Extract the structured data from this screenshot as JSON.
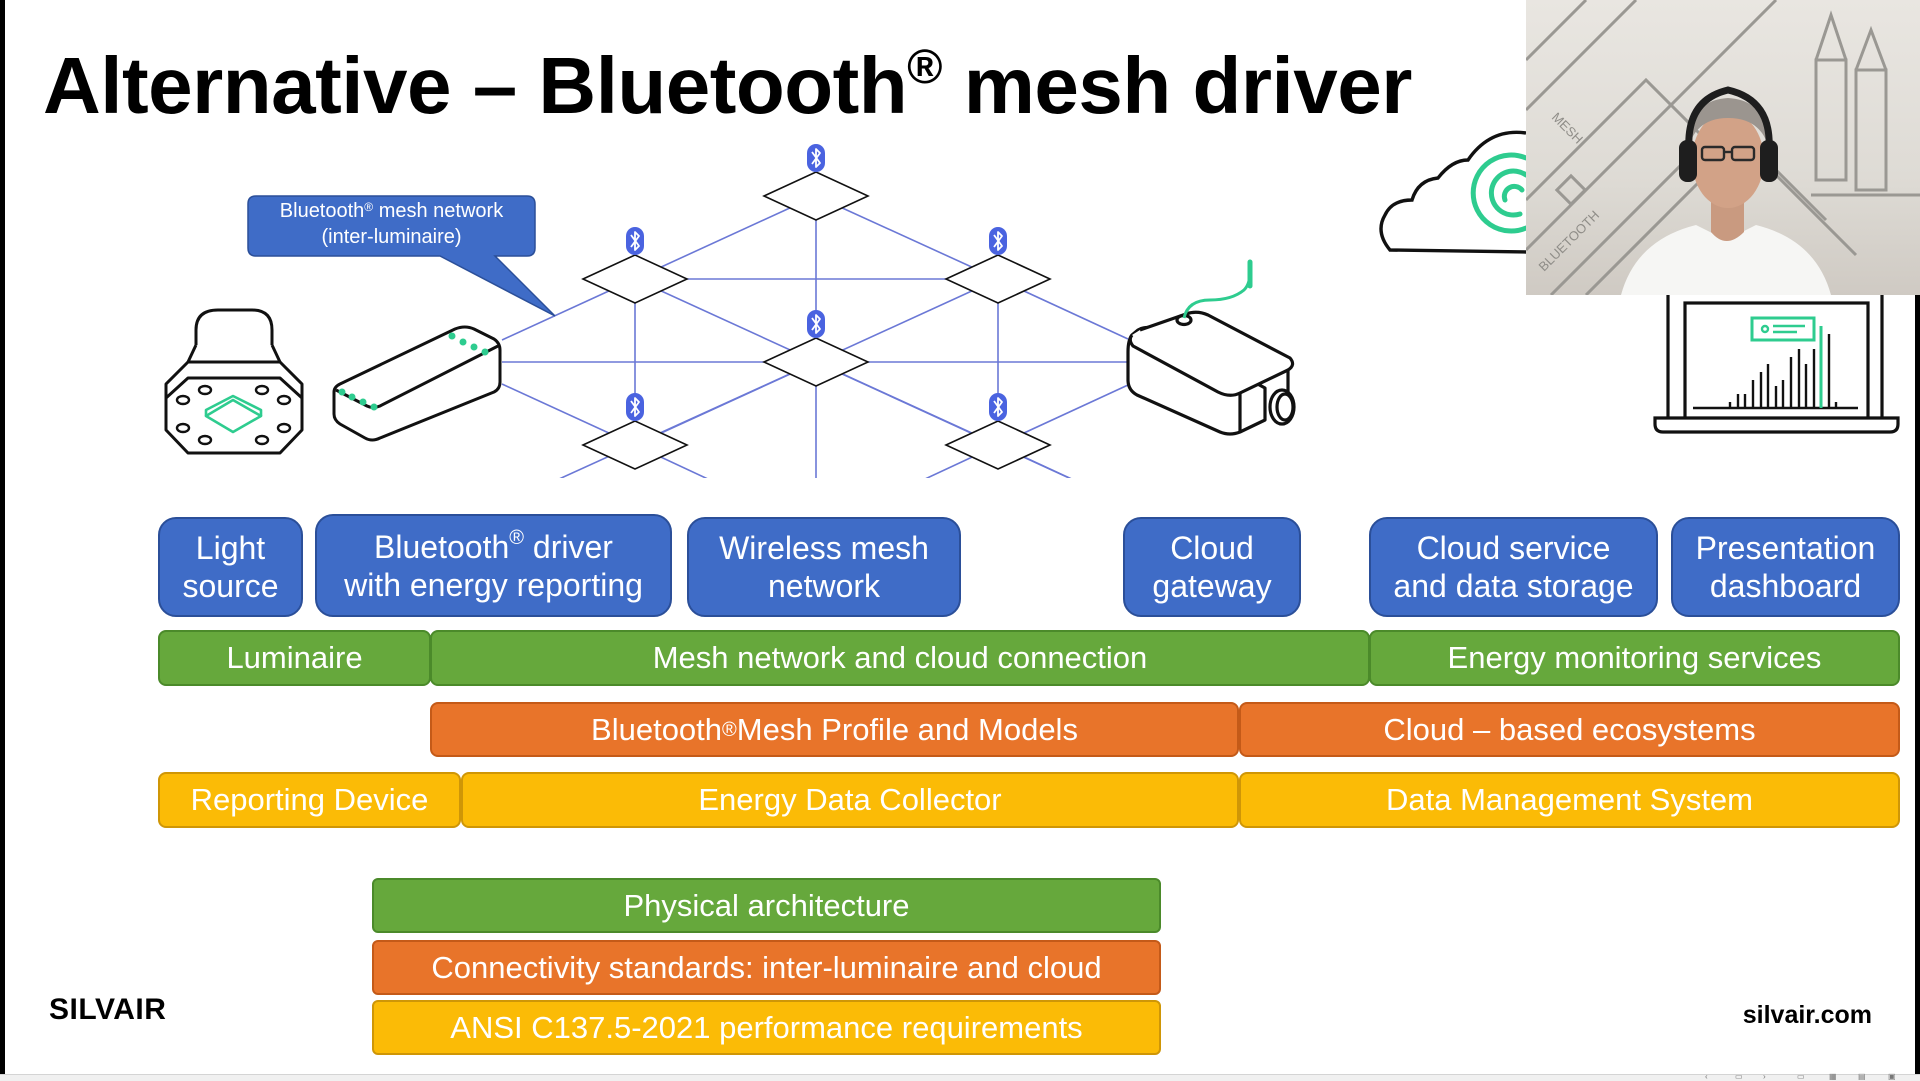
{
  "slide": {
    "title_main": "Alternative – Bluetooth",
    "title_reg": "®",
    "title_tail": " mesh driver",
    "brand_logo": "SILVAIR",
    "website": "silvair.com"
  },
  "callout": {
    "line1_a": "Bluetooth",
    "line1_reg": "®",
    "line1_b": " mesh network",
    "line2": "(inter-luminaire)"
  },
  "diagram": {
    "icons": [
      "luminaire-icon",
      "bluetooth-driver-icon",
      "mesh-network-diagram",
      "cloud-gateway-icon",
      "cloud-icon",
      "laptop-dashboard-icon"
    ],
    "mesh_nodes": 6,
    "accent_green": "#2ecc8f",
    "mesh_line_color": "#6b78d6",
    "bluetooth_badge_color": "#4a63e0"
  },
  "components": [
    {
      "id": "light-source",
      "line1": "Light",
      "line2": "source"
    },
    {
      "id": "bluetooth-driver",
      "line1_a": "Bluetooth",
      "line1_reg": "®",
      "line1_b": " driver",
      "line2": "with energy reporting"
    },
    {
      "id": "wireless-mesh",
      "line1": "Wireless mesh",
      "line2": "network"
    },
    {
      "id": "cloud-gateway",
      "line1": "Cloud",
      "line2": "gateway"
    },
    {
      "id": "cloud-service",
      "line1": "Cloud service",
      "line2": "and data storage"
    },
    {
      "id": "presentation-dashboard",
      "line1": "Presentation",
      "line2": "dashboard"
    }
  ],
  "layers": {
    "physical": [
      "Luminaire",
      "Mesh network and cloud connection",
      "Energy monitoring services"
    ],
    "connectivity": {
      "mesh_a": "Bluetooth",
      "mesh_reg": "®",
      "mesh_b": " Mesh Profile and Models",
      "cloud": "Cloud – based ecosystems"
    },
    "performance": [
      "Reporting Device",
      "Energy Data Collector",
      "Data Management System"
    ]
  },
  "legend": [
    {
      "label": "Physical architecture",
      "color": "#66a83c"
    },
    {
      "label": "Connectivity standards: inter-luminaire and cloud",
      "color": "#e8742a"
    },
    {
      "label": "ANSI C137.5-2021 performance requirements",
      "color": "#fbbb06"
    }
  ],
  "colors": {
    "blue": "#3f6cc7",
    "green": "#66a83c",
    "orange": "#e8742a",
    "yellow": "#fbbb06"
  },
  "webcam": {
    "wall_text_1": "MESH",
    "wall_text_2": "BLUETOOTH"
  },
  "slideshow_controls": [
    "previous-slide",
    "slide-menu",
    "next-slide",
    "normal-view",
    "slide-sorter-view",
    "reading-view",
    "slide-show-view"
  ]
}
